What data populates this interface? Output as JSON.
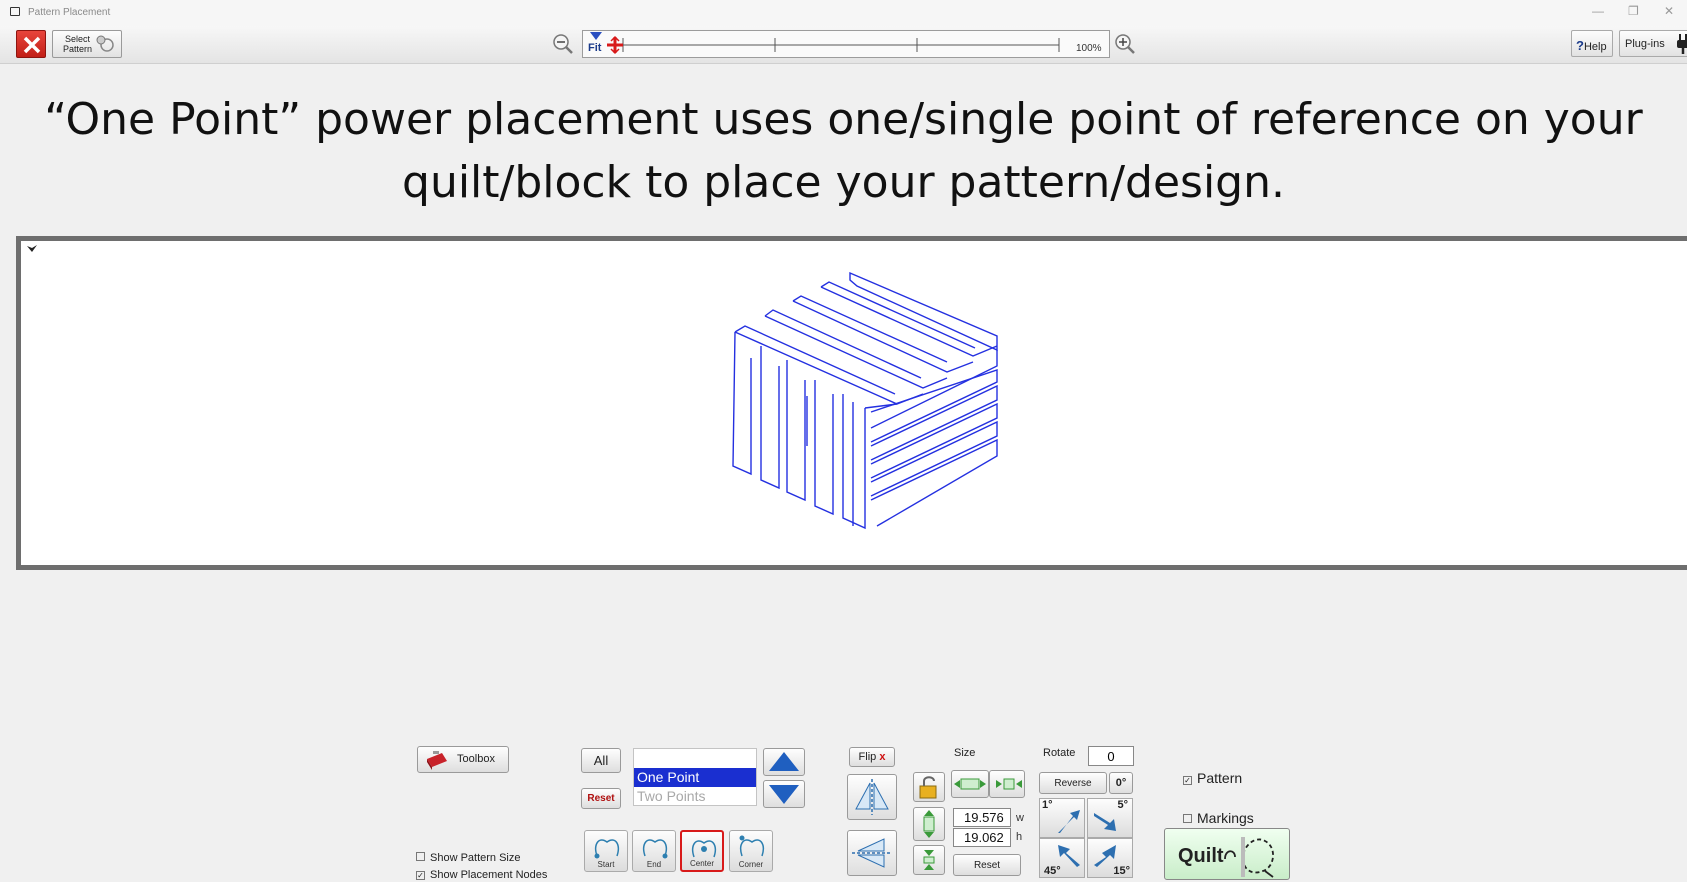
{
  "window": {
    "title": "Pattern Placement",
    "minimize": "—",
    "restore": "❐",
    "close": "✕"
  },
  "toolbar": {
    "select_pattern_line1": "Select",
    "select_pattern_line2": "Pattern",
    "fit_label": "Fit",
    "zoom_percent": "100%",
    "help_label": "Help",
    "help_mark": "?",
    "plugins_label": "Plug-ins"
  },
  "caption": {
    "line1": "“One Point” power placement uses one/single point of reference on your",
    "line2": "quilt/block to place your pattern/design."
  },
  "controls": {
    "toolbox_label": "Toolbox",
    "all_label": "All",
    "reset_label": "Reset",
    "placement_options": [
      "One Point",
      "Two Points"
    ],
    "selected_option": "One Point",
    "node_buttons": [
      "Start",
      "End",
      "Center",
      "Corner"
    ],
    "selected_node": "Center",
    "show_pattern_size": {
      "label": "Show Pattern Size",
      "checked": false
    },
    "show_placement_nodes": {
      "label": "Show Placement Nodes",
      "checked": true
    },
    "flip_label": "Flip",
    "flip_mark": "x",
    "size_label": "Size",
    "width_value": "19.576",
    "width_unit": "w",
    "height_value": "19.062",
    "height_unit": "h",
    "size_reset_label": "Reset",
    "rotate_label": "Rotate",
    "rotate_value": "0",
    "reverse_label": "Reverse",
    "zero_label": "0°",
    "rot_small": "1°",
    "rot_med": "5°",
    "rot_large": "45°",
    "rot_fifteen": "15°",
    "pattern_check": {
      "label": "Pattern",
      "checked": true
    },
    "markings_check": {
      "label": "Markings",
      "checked": false
    },
    "quilt_label": "Quilt"
  },
  "colors": {
    "pattern_stroke": "#2430e0",
    "selection": "#1a2fd0",
    "highlight": "#d81a1a",
    "quilt_button": "#c9edc9"
  }
}
